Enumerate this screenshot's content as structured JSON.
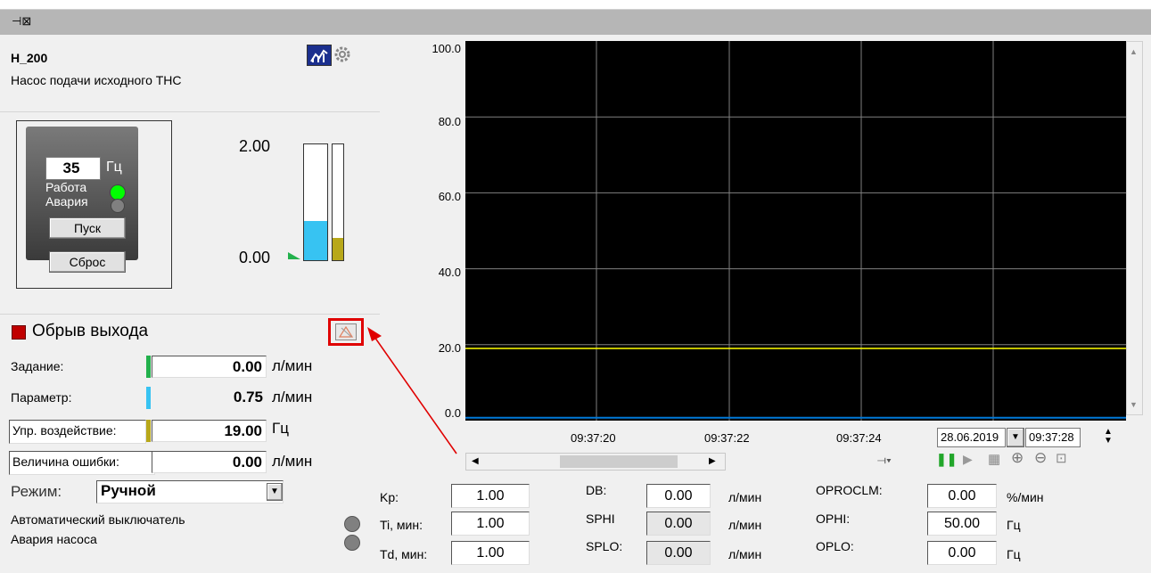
{
  "window": {
    "pin_icon": "pin-icon"
  },
  "device": {
    "tag": "H_200",
    "description": "Насос подачи исходного ТНС",
    "freq_value": "35",
    "freq_unit": "Гц",
    "run_label": "Работа",
    "fault_label": "Авария",
    "start_button": "Пуск",
    "reset_button": "Сброс",
    "run_color": "#00ff00",
    "fault_color": "#808080"
  },
  "gauge": {
    "max_label": "2.00",
    "min_label": "0.00",
    "bar1_fill": 0.34,
    "bar2_fill": 0.19,
    "bar1_color": "#37c3f2",
    "bar2_color": "#b8a81a"
  },
  "alarm": {
    "label": "Обрыв выхода"
  },
  "params": [
    {
      "label": "Задание:",
      "value": "0.00",
      "unit": "л/мин",
      "color": "#22b14c",
      "box": true
    },
    {
      "label": "Параметр:",
      "value": "0.75",
      "unit": "л/мин",
      "color": "#37c3f2",
      "box": false
    },
    {
      "label": "Упр. воздействие:",
      "value": "19.00",
      "unit": "Гц",
      "color": "#b8a81a",
      "box": true
    },
    {
      "label": "Величина ошибки:",
      "value": "0.00",
      "unit": "л/мин",
      "color": "",
      "box": true
    }
  ],
  "mode": {
    "label": "Режим:",
    "value": "Ручной"
  },
  "status": {
    "breaker": "Автоматический  выключатель",
    "pump_fault": "Авария насоса"
  },
  "chart": {
    "y_ticks": [
      "100.0",
      "80.0",
      "60.0",
      "40.0",
      "20.0",
      "0.0"
    ],
    "x_ticks": [
      "09:37:20",
      "09:37:22",
      "09:37:24"
    ],
    "date": "28.06.2019",
    "time": "09:37:28"
  },
  "chart_data": {
    "type": "line",
    "ylim": [
      0,
      100
    ],
    "x": [
      "09:37:20",
      "09:37:22",
      "09:37:24"
    ],
    "series": [
      {
        "values": [
          19,
          19,
          19
        ],
        "color": "#ffff00"
      },
      {
        "values": [
          0.75,
          0.75,
          0.75
        ],
        "color": "#0078d7"
      }
    ],
    "grid": true
  },
  "pid": {
    "kp_label": "Kp:",
    "kp": "1.00",
    "ti_label": "Ti, мин:",
    "ti": "1.00",
    "td_label": "Td, мин:",
    "td": "1.00",
    "db_label": "DB:",
    "db": "0.00",
    "db_unit": "л/мин",
    "sphi_label": "SPHI",
    "sphi": "0.00",
    "sphi_unit": "л/мин",
    "splo_label": "SPLO:",
    "splo": "0.00",
    "splo_unit": "л/мин",
    "oproclm_label": "OPROCLM:",
    "oproclm": "0.00",
    "oproclm_unit": "%/мин",
    "ophi_label": "OPHI:",
    "ophi": "50.00",
    "ophi_unit": "Гц",
    "oplo_label": "OPLO:",
    "oplo": "0.00",
    "oplo_unit": "Гц"
  }
}
